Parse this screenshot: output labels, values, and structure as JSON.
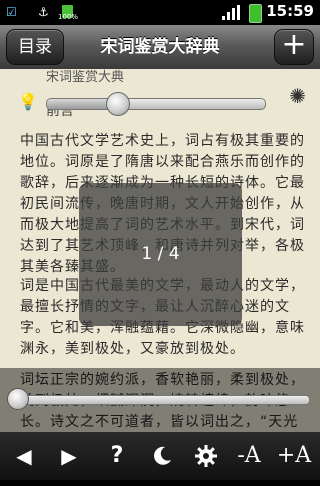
{
  "status_bar": {
    "time": "15:59",
    "battery_small_label": "100%",
    "icons": [
      "checkbox-icon",
      "usb-icon",
      "battery-full-icon",
      "signal-icon",
      "charging-battery-icon"
    ]
  },
  "header": {
    "back_label": "目录",
    "title": "宋词鉴赏大辞典",
    "add_label": "+"
  },
  "book": {
    "running_head": "宋词鉴赏大典",
    "section_title": "前言",
    "paragraphs": [
      "中国古代文学艺术史上，词占有极其重要的地位。词原是了隋唐以来配合燕乐而创作的歌辞，后来逐渐成为一种长短的诗体。它最初民间流传，晚唐时期，文人开始创作，从而极大地提高了词的艺术水平。到宋代，词达到了其艺术顶峰，和唐诗并列对举，各极其美各臻其盛。",
      "词是中国古代最美的文学，最动人的文学，最擅长抒情的文字，最让人沉醉心迷的文字。它和美，浑融蕴藉。它深微隐幽，意味渊永，美到极处，又豪放到极处。",
      "词坛正宗的婉约派，香软艳丽，柔到极处，美到极处，细腻深沉，婉转缠绵，韵味悠长。诗文之不可道者，皆以词出之，“天光云影，摇荡绿波，抚玩无释，追寻已远”"
    ]
  },
  "page_indicator": "1 / 4",
  "brightness_level": 0.32,
  "progress_level": 0.0,
  "toolbar": {
    "prev_label": "◀",
    "next_label": "▶",
    "help_label": "?",
    "font_decrease_label": "-A",
    "font_increase_label": "+A"
  }
}
